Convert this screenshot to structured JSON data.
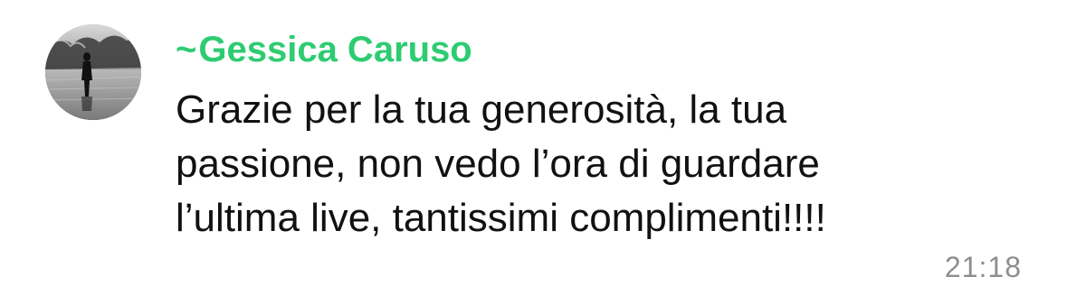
{
  "message": {
    "sender_prefix": "~",
    "sender_name": "Gessica Caruso",
    "sender_color": "#2ecc71",
    "text_lines": [
      "Grazie per la tua generosità, la tua",
      "passione, non vedo l’ora di guardare",
      "l’ultima live, tantissimi complimenti!!!!"
    ],
    "timestamp": "21:18",
    "avatar_icon": "profile-photo-person-by-water"
  }
}
